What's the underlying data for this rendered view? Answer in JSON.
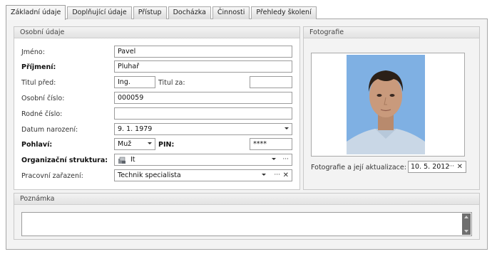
{
  "tabs": [
    {
      "label": "Základní údaje",
      "active": true
    },
    {
      "label": "Doplňující údaje",
      "active": false
    },
    {
      "label": "Přístup",
      "active": false
    },
    {
      "label": "Docházka",
      "active": false
    },
    {
      "label": "Činnosti",
      "active": false
    },
    {
      "label": "Přehledy školení",
      "active": false
    }
  ],
  "personal": {
    "header": "Osobní údaje",
    "jmeno_label": "Jméno:",
    "jmeno_value": "Pavel",
    "prijmeni_label": "Příjmení:",
    "prijmeni_value": "Pluhař",
    "titul_pred_label": "Titul před:",
    "titul_pred_value": "Ing.",
    "titul_za_label": "Titul za:",
    "titul_za_value": "",
    "osobni_cislo_label": "Osobní číslo:",
    "osobni_cislo_value": "000059",
    "rodne_cislo_label": "Rodné číslo:",
    "rodne_cislo_value": "",
    "datum_label": "Datum narození:",
    "datum_value": "9. 1. 1979",
    "pohlavi_label": "Pohlaví:",
    "pohlavi_value": "Muž",
    "pin_label": "PIN:",
    "pin_value": "****",
    "org_label": "Organizační struktura:",
    "org_value": "It",
    "prac_label": "Pracovní zařazení:",
    "prac_value": "Technik specialista",
    "ellipsis": "···",
    "clear": "✕"
  },
  "photo": {
    "header": "Fotografie",
    "update_label": "Fotografie a její aktualizace:",
    "update_date": "10. 5. 2012",
    "ellipsis": "···",
    "clear": "✕"
  },
  "note": {
    "header": "Poznámka",
    "value": ""
  },
  "colors": {
    "photo_bg": "#7fb0e3",
    "shirt": "#c9d7e6",
    "skin": "#c99a7c",
    "hair": "#2b2018"
  }
}
